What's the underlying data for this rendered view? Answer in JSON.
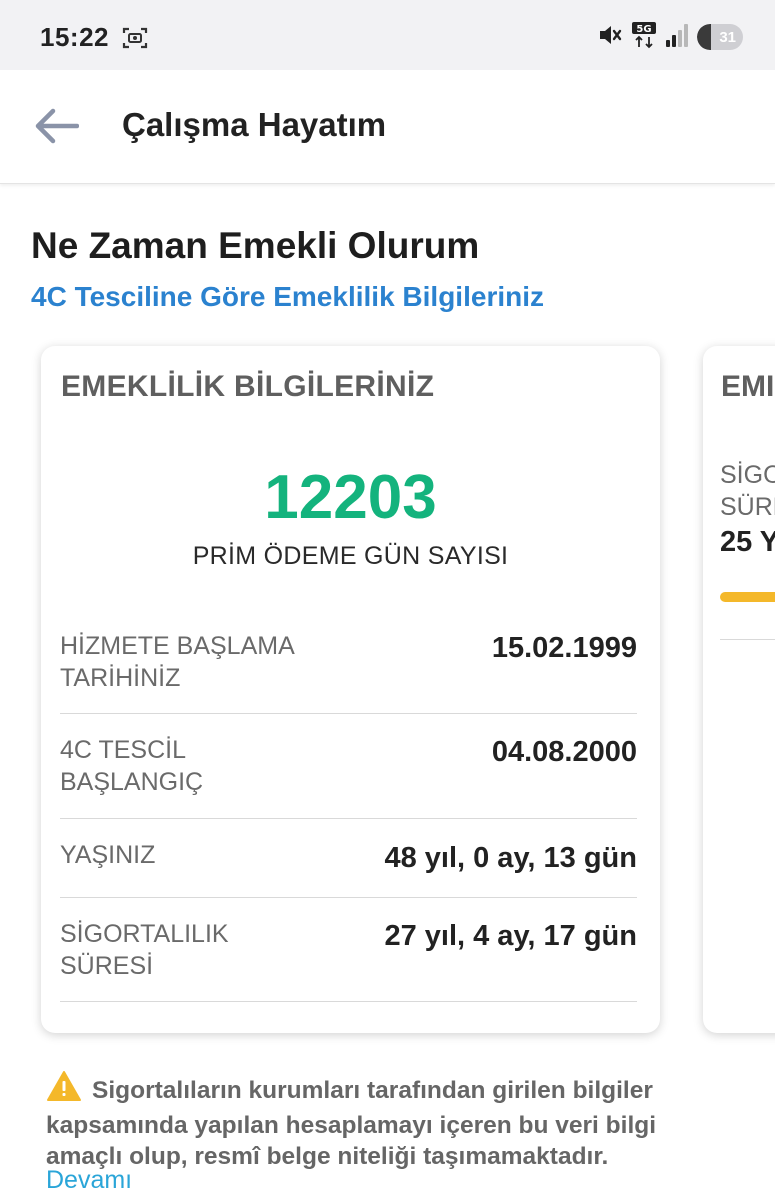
{
  "status_bar": {
    "time": "15:22",
    "battery": 31,
    "network": "5G",
    "icons": [
      "screen-record-icon",
      "mute-icon",
      "network-5g-icon",
      "signal-icon",
      "battery-icon"
    ]
  },
  "app_bar": {
    "title": "Çalışma Hayatım",
    "back_icon": "arrow-left-icon"
  },
  "page": {
    "title": "Ne Zaman Emekli Olurum",
    "subtitle": "4C Tesciline Göre Emeklilik Bilgileriniz"
  },
  "card": {
    "heading": "EMEKLİLİK BİLGİLERİNİZ",
    "premium_days": "12203",
    "premium_days_label": "PRİM ÖDEME GÜN SAYISI",
    "rows": [
      {
        "label_lines": [
          "HİZMETE BAŞLAMA",
          "TARİHİNİZ"
        ],
        "value": "15.02.1999"
      },
      {
        "label_lines": [
          "4C TESCİL",
          "BAŞLANGIÇ"
        ],
        "value": "04.08.2000"
      },
      {
        "label_lines": [
          "YAŞINIZ"
        ],
        "value": "48 yıl, 0 ay, 13 gün"
      },
      {
        "label_lines": [
          "SİGORTALILIK",
          "SÜRESİ"
        ],
        "value": "27 yıl, 4 ay, 17 gün"
      }
    ]
  },
  "next_card": {
    "heading": "EMI",
    "label_lines": [
      "SİGO",
      "SÜRE"
    ],
    "value": "25 Y",
    "bar_color": "#f4b82a"
  },
  "notice": {
    "icon": "warning-icon",
    "text": "Sigortalıların kurumları tarafından girilen bilgiler kapsamında yapılan hesaplamayı içeren bu veri bilgi amaçlı olup, resmî belge niteliği taşımamaktadır.",
    "more_link": "Devamı"
  },
  "colors": {
    "accent_green": "#14b37d",
    "accent_blue": "#2b82cf",
    "link_blue": "#2aa5d8",
    "warning_yellow": "#f4b82a"
  }
}
